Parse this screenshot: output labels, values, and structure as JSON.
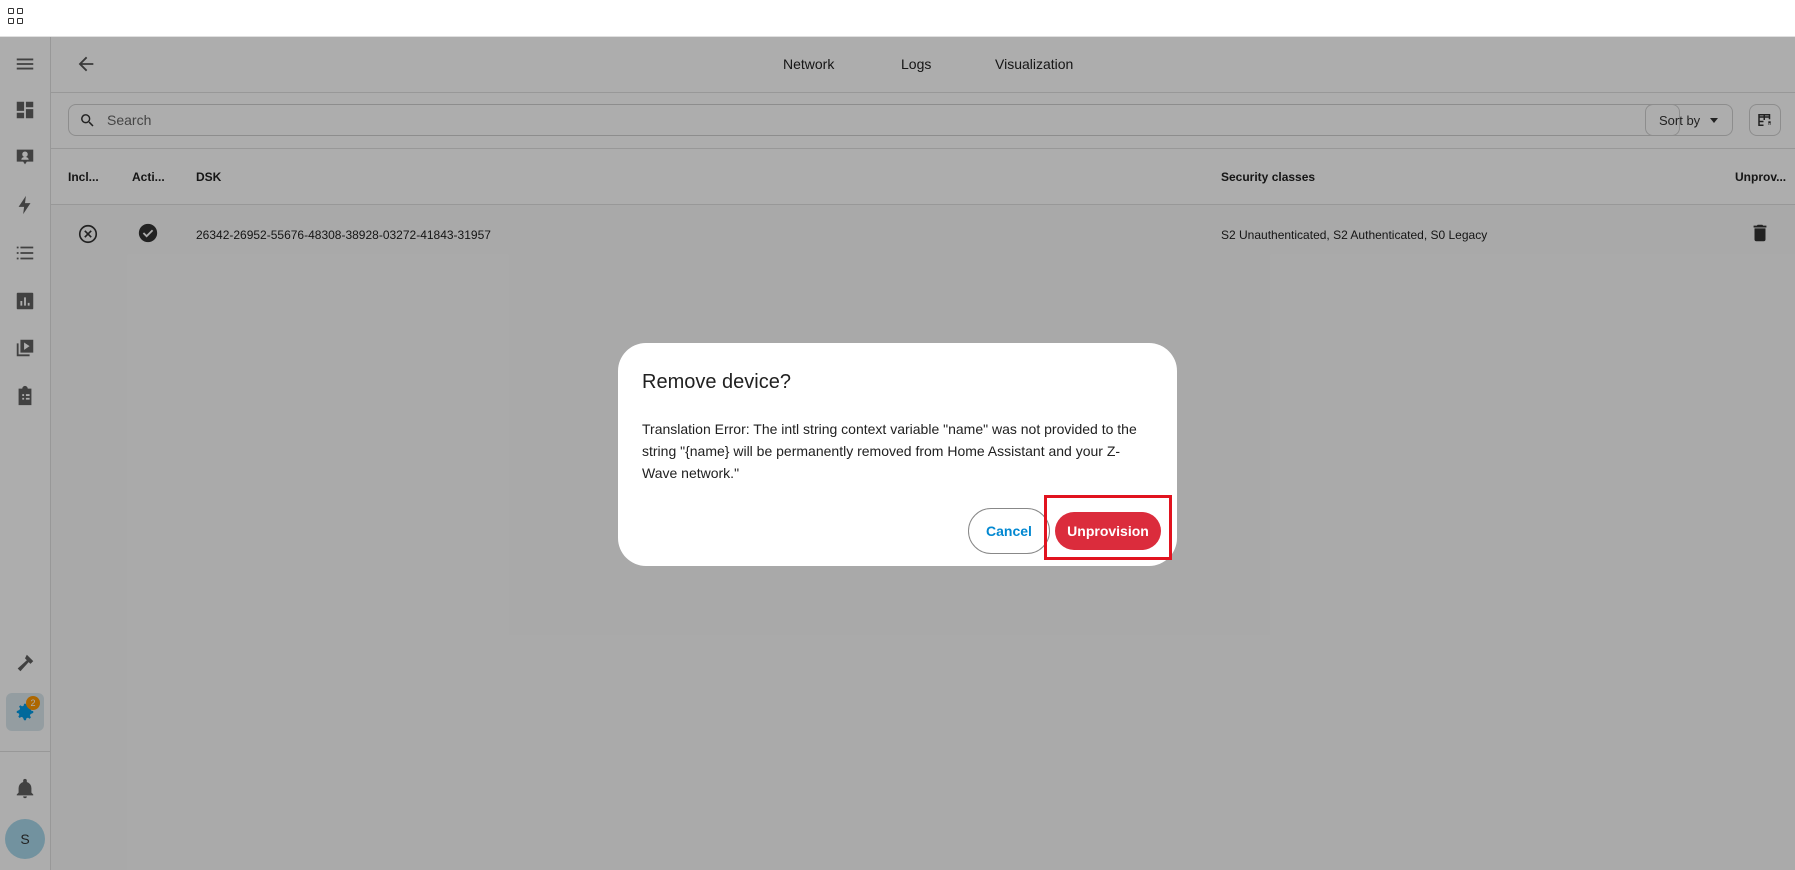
{
  "header": {
    "tabs": [
      "Network",
      "Logs",
      "Visualization"
    ]
  },
  "search": {
    "placeholder": "Search"
  },
  "toolbar": {
    "sort_label": "Sort by"
  },
  "sidebar": {
    "items": [
      "menu-icon",
      "dashboard-icon",
      "map-icon",
      "energy-icon",
      "logbook-icon",
      "history-icon",
      "media-icon",
      "todo-icon"
    ],
    "badge_count": "2",
    "avatar_initial": "S"
  },
  "table": {
    "columns": [
      "Incl...",
      "Acti...",
      "DSK",
      "Security classes",
      "Unprov..."
    ],
    "rows": [
      {
        "dsk": "26342-26952-55676-48308-38928-03272-41843-31957",
        "security_classes": "S2 Unauthenticated, S2 Authenticated, S0 Legacy"
      }
    ]
  },
  "dialog": {
    "title": "Remove device?",
    "body": "Translation Error: The intl string context variable \"name\" was not provided to the string \"{name} will be permanently removed from Home Assistant and your Z-Wave network.\"",
    "cancel_label": "Cancel",
    "confirm_label": "Unprovision"
  },
  "colors": {
    "accent": "#039be5",
    "danger": "#db2c3c",
    "highlight": "#e1131f"
  }
}
